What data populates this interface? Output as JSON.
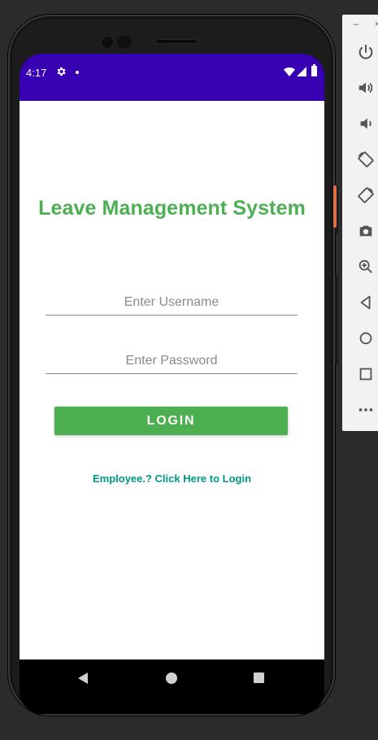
{
  "status_bar": {
    "time": "4:17",
    "color": "#3700b3"
  },
  "app": {
    "title": "Leave Management System",
    "title_color": "#4caf50",
    "username_placeholder": "Enter Username",
    "password_placeholder": "Enter Password",
    "login_label": "LOGIN",
    "employee_link": "Employee.? Click Here to Login",
    "link_color": "#009688"
  },
  "emulator_toolbar": {
    "minimize_label": "–",
    "close_label": "×",
    "buttons": [
      "power-icon",
      "volume-up-icon",
      "volume-down-icon",
      "rotate-left-icon",
      "rotate-right-icon",
      "camera-icon",
      "zoom-icon",
      "back-icon",
      "home-icon",
      "overview-icon",
      "more-icon"
    ]
  }
}
